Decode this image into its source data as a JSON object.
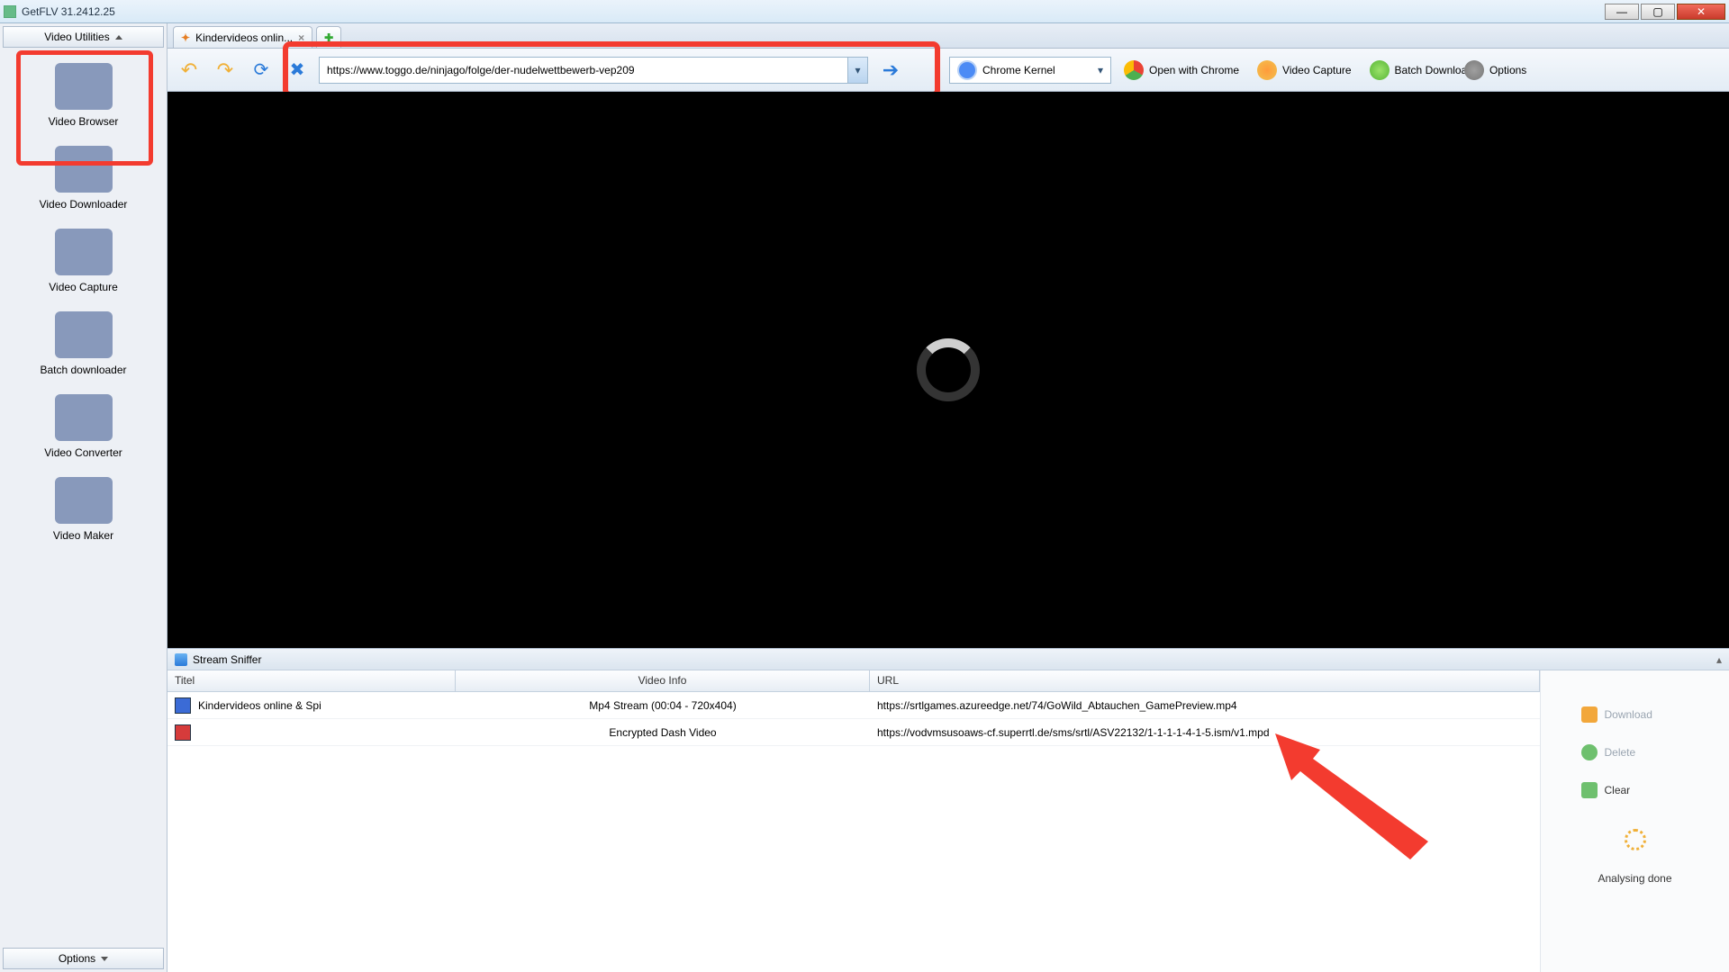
{
  "window": {
    "title": "GetFLV 31.2412.25"
  },
  "leftHeader": "Video Utilities",
  "leftFooter": "Options",
  "sidebar": {
    "items": [
      {
        "label": "Video Browser"
      },
      {
        "label": "Video Downloader"
      },
      {
        "label": "Video Capture"
      },
      {
        "label": "Batch downloader"
      },
      {
        "label": "Video Converter"
      },
      {
        "label": "Video Maker"
      }
    ]
  },
  "tabs": {
    "active": "Kindervideos onlin..."
  },
  "toolbar": {
    "url": "https://www.toggo.de/ninjago/folge/der-nudelwettbewerb-vep209",
    "kernel": "Chrome Kernel",
    "openChrome": "Open with Chrome",
    "videoCapture": "Video Capture",
    "batch": "Batch Download",
    "options": "Options"
  },
  "sniffer": {
    "title": "Stream Sniffer",
    "columns": {
      "titel": "Titel",
      "info": "Video Info",
      "url": "URL"
    },
    "rows": [
      {
        "titel": "Kindervideos online & Spi",
        "info": "Mp4 Stream (00:04 - 720x404)",
        "url": "https://srtlgames.azureedge.net/74/GoWild_Abtauchen_GamePreview.mp4"
      },
      {
        "titel": "",
        "info": "Encrypted Dash Video",
        "url": "https://vodvmsusoaws-cf.superrtl.de/sms/srtl/ASV22132/1-1-1-1-4-1-5.ism/v1.mpd"
      }
    ],
    "actions": {
      "download": "Download",
      "delete": "Delete",
      "clear": "Clear",
      "status": "Analysing done"
    }
  }
}
